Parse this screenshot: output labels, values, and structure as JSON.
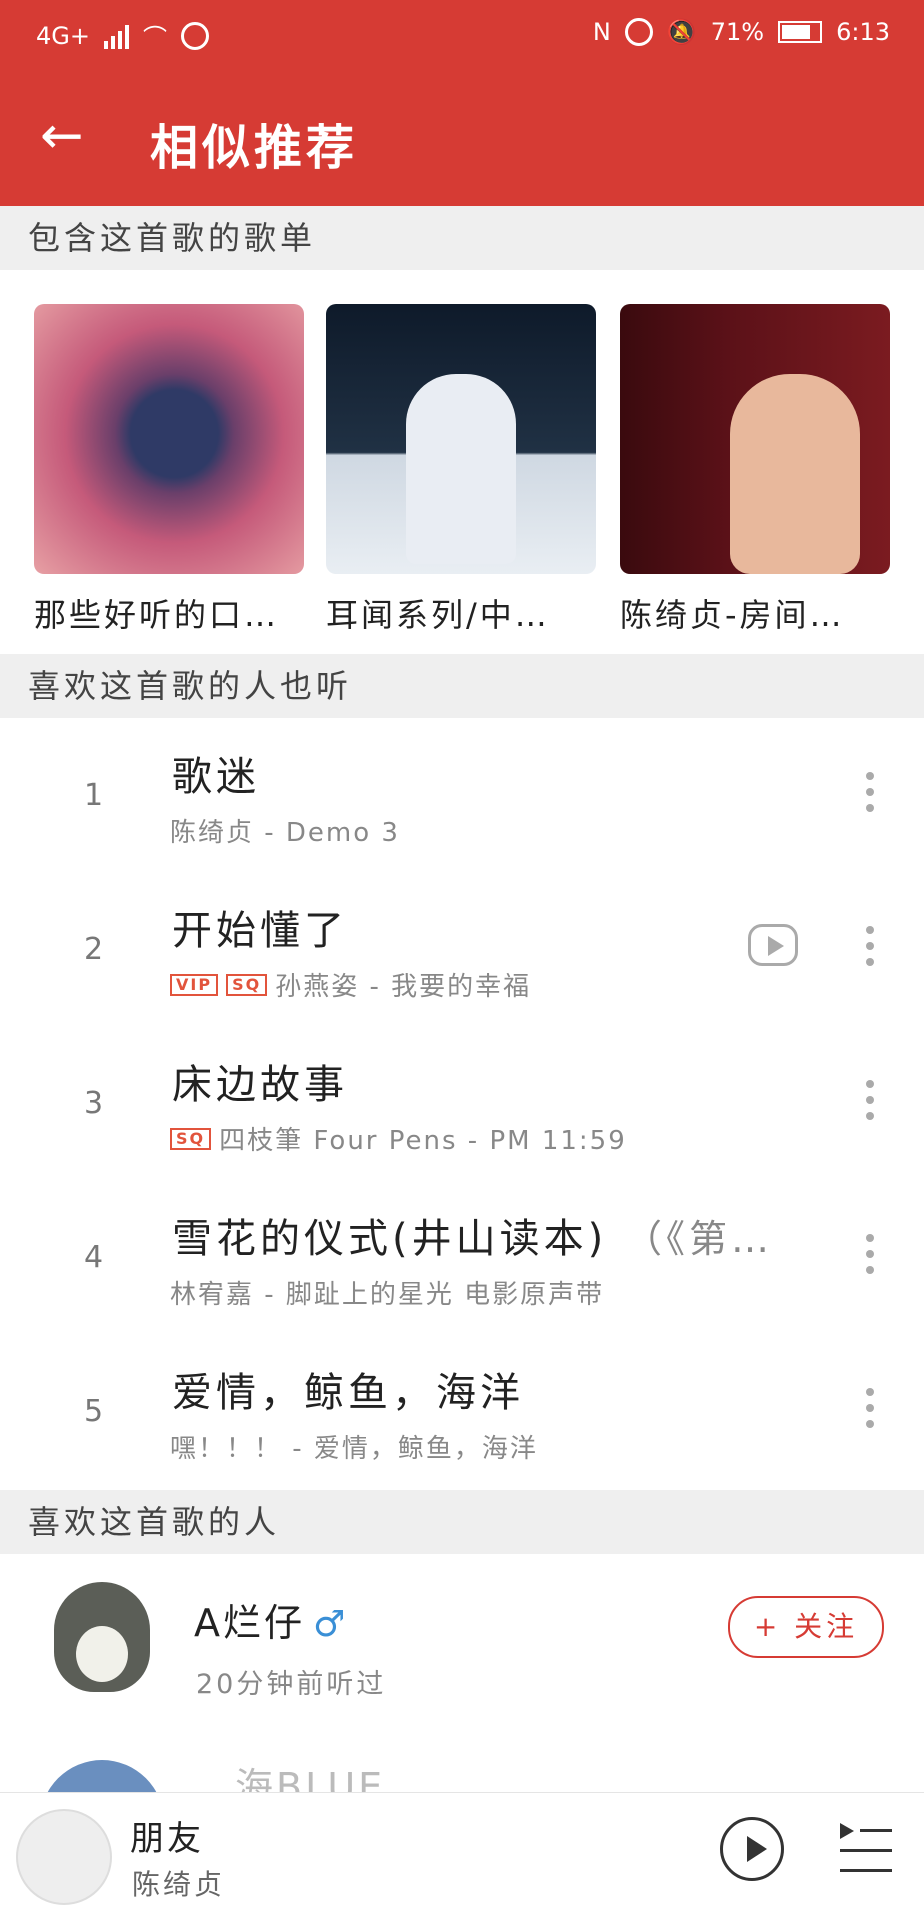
{
  "status": {
    "network": "4G+",
    "battery": "71%",
    "time": "6:13"
  },
  "header": {
    "title": "相似推荐"
  },
  "sections": {
    "playlists": "包含这首歌的歌单",
    "songs": "喜欢这首歌的人也听",
    "users": "喜欢这首歌的人"
  },
  "playlists": [
    {
      "name": "那些好听的口…"
    },
    {
      "name": "耳闻系列/中…"
    },
    {
      "name": "陈绮贞-房间…"
    }
  ],
  "songs": [
    {
      "index": "1",
      "title": "歌迷",
      "extra": "",
      "subtitle": "陈绮贞 - Demo 3",
      "tags": []
    },
    {
      "index": "2",
      "title": "开始懂了",
      "extra": "",
      "subtitle": "孙燕姿 - 我要的幸福",
      "tags": [
        "VIP",
        "SQ"
      ]
    },
    {
      "index": "3",
      "title": "床边故事",
      "extra": "",
      "subtitle": "四枝筆 Four Pens - PM 11:59",
      "tags": [
        "SQ"
      ]
    },
    {
      "index": "4",
      "title": "雪花的仪式(井山读本)",
      "extra": "（《第…",
      "subtitle": "林宥嘉 - 脚趾上的星光 电影原声带",
      "tags": []
    },
    {
      "index": "5",
      "title": "爱情，鲸鱼，海洋",
      "extra": "",
      "subtitle": "嘿！！！ - 爱情，鲸鱼，海洋",
      "tags": []
    }
  ],
  "users": [
    {
      "name": "A烂仔",
      "gender": "♂",
      "sub": "20分钟前听过",
      "follow": "+ 关注"
    },
    {
      "name": "…海BLUE"
    }
  ],
  "player": {
    "title": "朋友",
    "artist": "陈绮贞"
  },
  "colors": {
    "accent": "#d63b34"
  }
}
